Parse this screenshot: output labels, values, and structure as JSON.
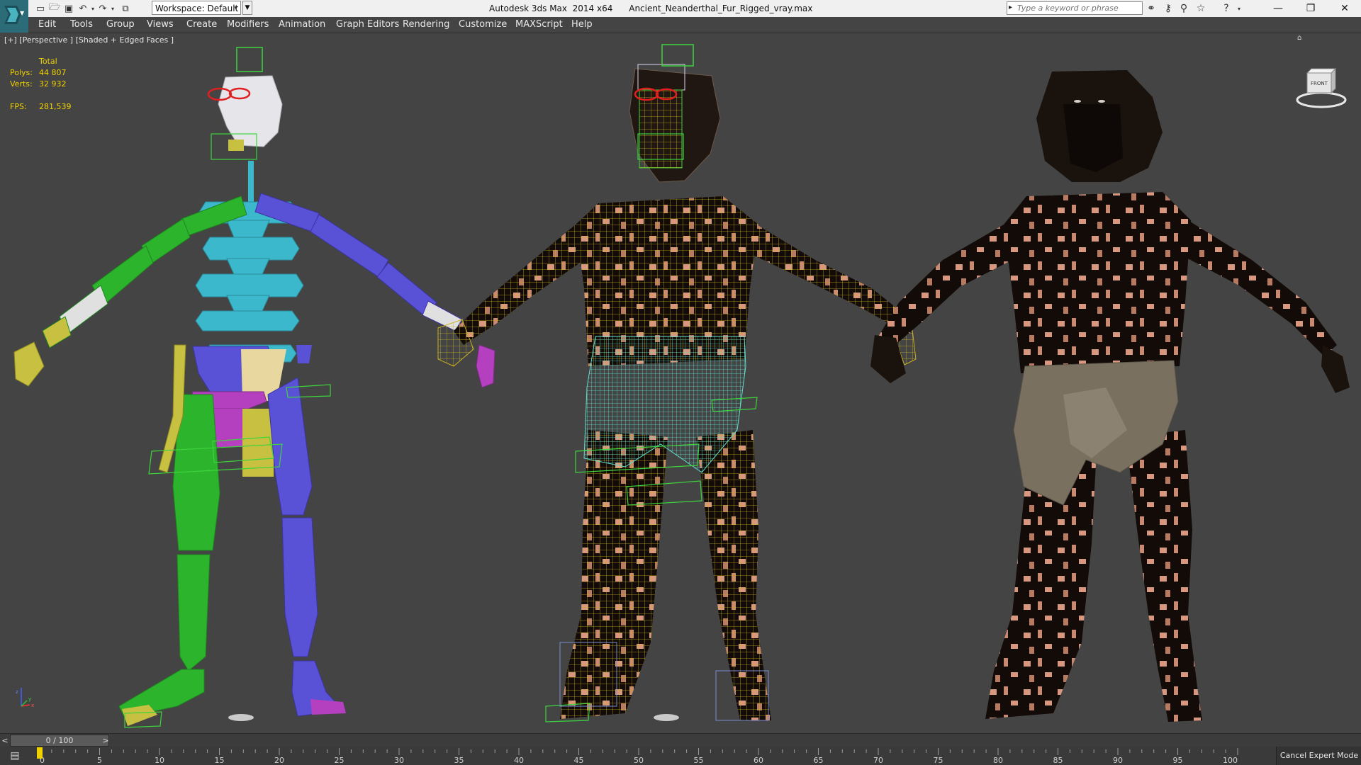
{
  "app": {
    "window_title": "Autodesk 3ds Max  2014 x64      Ancient_Neanderthal_Fur_Rigged_vray.max",
    "workspace_label": "Workspace: Default",
    "search_placeholder": "Type a keyword or phrase"
  },
  "menu": {
    "items": [
      {
        "label": "Edit"
      },
      {
        "label": "Tools"
      },
      {
        "label": "Group"
      },
      {
        "label": "Views"
      },
      {
        "label": "Create"
      },
      {
        "label": "Modifiers"
      },
      {
        "label": "Animation"
      },
      {
        "label": "Graph Editors"
      },
      {
        "label": "Rendering"
      },
      {
        "label": "Customize"
      },
      {
        "label": "MAXScript"
      },
      {
        "label": "Help"
      }
    ]
  },
  "viewport": {
    "label": "[+] [Perspective ] [Shaded + Edged Faces ]",
    "stats": {
      "header": "Total",
      "polys_label": "Polys:",
      "polys_value": "44 807",
      "verts_label": "Verts:",
      "verts_value": "32 932",
      "fps_label": "FPS:",
      "fps_value": "281,539"
    },
    "viewcube_label": "FRONT"
  },
  "timeline": {
    "frame_display": "0 / 100",
    "current_frame": 0,
    "total_frames": 100,
    "ruler_ticks": [
      "0",
      "5",
      "10",
      "15",
      "20",
      "25",
      "30",
      "35",
      "40",
      "45",
      "50",
      "55",
      "60",
      "65",
      "70",
      "75",
      "80",
      "85",
      "90",
      "95",
      "100"
    ]
  },
  "status": {
    "cancel_expert_label": "Cancel Expert Mode"
  },
  "colors": {
    "viewport_bg": "#444444",
    "stats_text": "#f0d100",
    "app_logo": "#2b6c78",
    "bone_green": "#2db42d",
    "bone_cyan": "#3cb8cc",
    "bone_blue": "#5a52d6",
    "bone_magenta": "#b440c0",
    "bone_yellow": "#c8c040",
    "wire_yellow": "#c8b020",
    "wire_cyan": "#60e0d0",
    "skin_dark": "#120b08",
    "skin_patch": "#d89880",
    "loincloth": "#7a7060"
  }
}
